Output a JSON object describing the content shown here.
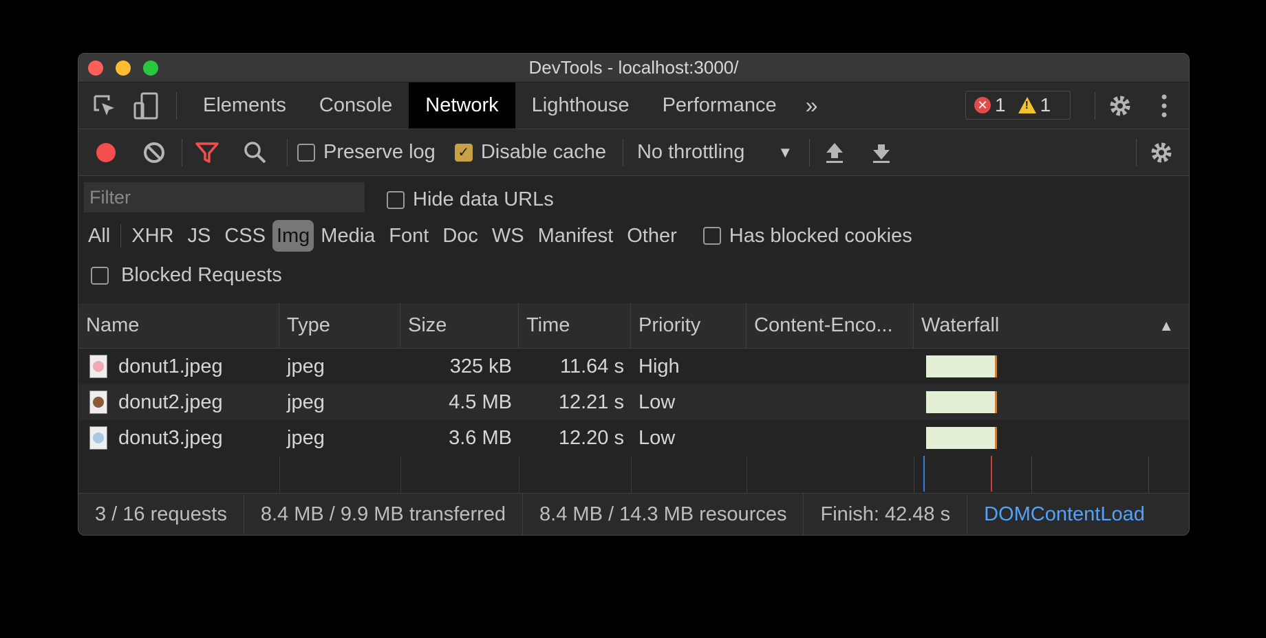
{
  "window": {
    "title": "DevTools - localhost:3000/"
  },
  "tabs": [
    "Elements",
    "Console",
    "Network",
    "Lighthouse",
    "Performance"
  ],
  "active_tab": "Network",
  "more_tabs_label": "»",
  "badges": {
    "errors": "1",
    "warnings": "1"
  },
  "toolbar": {
    "preserve_log": {
      "label": "Preserve log",
      "checked": false
    },
    "disable_cache": {
      "label": "Disable cache",
      "checked": true
    },
    "throttling": "No throttling"
  },
  "filter": {
    "placeholder": "Filter",
    "hide_data_urls": "Hide data URLs"
  },
  "types": [
    "All",
    "XHR",
    "JS",
    "CSS",
    "Img",
    "Media",
    "Font",
    "Doc",
    "WS",
    "Manifest",
    "Other"
  ],
  "active_type": "Img",
  "has_blocked_cookies": "Has blocked cookies",
  "blocked_requests": "Blocked Requests",
  "columns": [
    "Name",
    "Type",
    "Size",
    "Time",
    "Priority",
    "Content-Enco...",
    "Waterfall"
  ],
  "rows": [
    {
      "name": "donut1.jpeg",
      "type": "jpeg",
      "size": "325 kB",
      "time": "11.64 s",
      "priority": "High",
      "thumb": "#f0a8b8"
    },
    {
      "name": "donut2.jpeg",
      "type": "jpeg",
      "size": "4.5 MB",
      "time": "12.21 s",
      "priority": "Low",
      "thumb": "#8a5a3a"
    },
    {
      "name": "donut3.jpeg",
      "type": "jpeg",
      "size": "3.6 MB",
      "time": "12.20 s",
      "priority": "Low",
      "thumb": "#a8c8e8"
    }
  ],
  "status": {
    "requests": "3 / 16 requests",
    "transferred": "8.4 MB / 9.9 MB transferred",
    "resources": "8.4 MB / 14.3 MB resources",
    "finish": "Finish: 42.48 s",
    "dcl": "DOMContentLoad"
  },
  "colors": {
    "record": "#f24e4e",
    "filter_active": "#f24e4e",
    "link": "#4ea3ff",
    "checkbox": "#c8a146"
  }
}
